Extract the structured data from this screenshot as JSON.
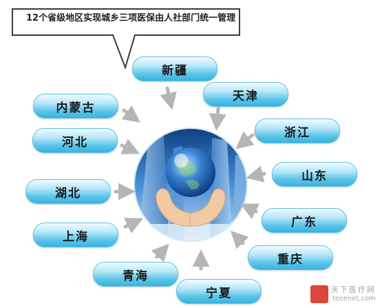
{
  "callout": {
    "text": "12个省级地区实现城乡三项医保由人社部门统一管理"
  },
  "regions": [
    {
      "key": "xinjiang",
      "label": "新疆"
    },
    {
      "key": "tianjin",
      "label": "天津"
    },
    {
      "key": "zhejiang",
      "label": "浙江"
    },
    {
      "key": "shandong",
      "label": "山东"
    },
    {
      "key": "guangdong",
      "label": "广东"
    },
    {
      "key": "chongqing",
      "label": "重庆"
    },
    {
      "key": "ningxia",
      "label": "宁夏"
    },
    {
      "key": "qinghai",
      "label": "青海"
    },
    {
      "key": "shanghai",
      "label": "上海"
    },
    {
      "key": "hubei",
      "label": "湖北"
    },
    {
      "key": "hebei",
      "label": "河北"
    },
    {
      "key": "neimenggu",
      "label": "内蒙古"
    }
  ],
  "watermark": {
    "name": "天下医疗网",
    "url": "tecenet.com"
  },
  "colors": {
    "pill": "#37b2df",
    "arrow": "#b5b5b5",
    "globe": "#1f5fae"
  }
}
